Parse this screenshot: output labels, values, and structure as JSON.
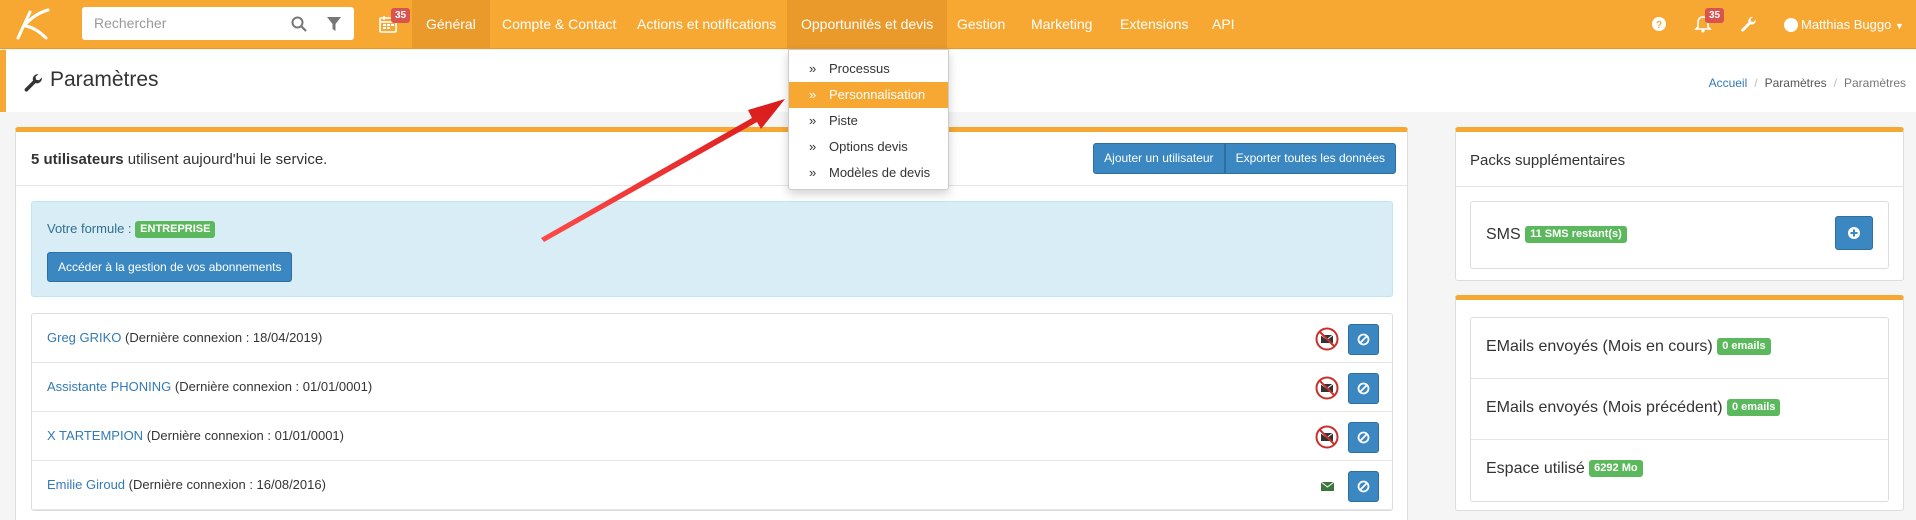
{
  "colors": {
    "nav_orange": "#f7a833",
    "nav_active": "#e99a2a",
    "primary_blue": "#3a87c1",
    "success_green": "#5cb85c",
    "danger_red": "#d9534f",
    "arrow_red": "#e8262a"
  },
  "topnav": {
    "logo_icon": "brand-k-logo",
    "search_placeholder": "Rechercher",
    "calendar_badge": "35",
    "notif_badge": "35",
    "items": [
      {
        "label": "Général",
        "active": true
      },
      {
        "label": "Compte & Contact"
      },
      {
        "label": "Actions et notifications"
      },
      {
        "label": "Opportunités et devis",
        "open": true
      },
      {
        "label": "Gestion"
      },
      {
        "label": "Marketing"
      },
      {
        "label": "Extensions"
      },
      {
        "label": "API"
      }
    ],
    "user_name": "Matthias Buggo"
  },
  "dropdown": {
    "items": [
      {
        "label": "Processus"
      },
      {
        "label": "Personnalisation",
        "highlighted": true
      },
      {
        "label": "Piste"
      },
      {
        "label": "Options devis"
      },
      {
        "label": "Modèles de devis"
      }
    ]
  },
  "page": {
    "title": "Paramètres",
    "breadcrumb": [
      "Accueil",
      "Paramètres",
      "Paramètres"
    ]
  },
  "users_panel": {
    "count_bold": "5 utilisateurs",
    "count_rest": " utilisent aujourd'hui le service.",
    "add_user": "Ajouter un utilisateur",
    "export_all": "Exporter toutes les données",
    "formule_label": "Votre formule :",
    "formule_badge": "ENTREPRISE",
    "manage_subs": "Accéder à la gestion de vos abonnements",
    "users": [
      {
        "name": "Greg GRIKO",
        "detail": " (Dernière connexion : 18/04/2019)",
        "mail_icon": "mail-blocked-icon"
      },
      {
        "name": "Assistante PHONING",
        "detail": " (Dernière connexion : 01/01/0001)",
        "mail_icon": "mail-blocked-icon"
      },
      {
        "name": "X TARTEMPION",
        "detail": " (Dernière connexion : 01/01/0001)",
        "mail_icon": "mail-blocked-icon"
      },
      {
        "name": "Emilie Giroud",
        "detail": " (Dernière connexion : 16/08/2016)",
        "mail_icon": "mail-ok-icon"
      }
    ]
  },
  "packs_panel": {
    "title": "Packs supplémentaires",
    "sms_label": "SMS",
    "sms_badge": "11 SMS restant(s)"
  },
  "stats_panel": {
    "items": [
      {
        "label": "EMails envoyés (Mois en cours)",
        "badge": "0 emails"
      },
      {
        "label": "EMails envoyés (Mois précédent)",
        "badge": "0 emails"
      },
      {
        "label": "Espace utilisé",
        "badge": "6292 Mo"
      }
    ]
  }
}
